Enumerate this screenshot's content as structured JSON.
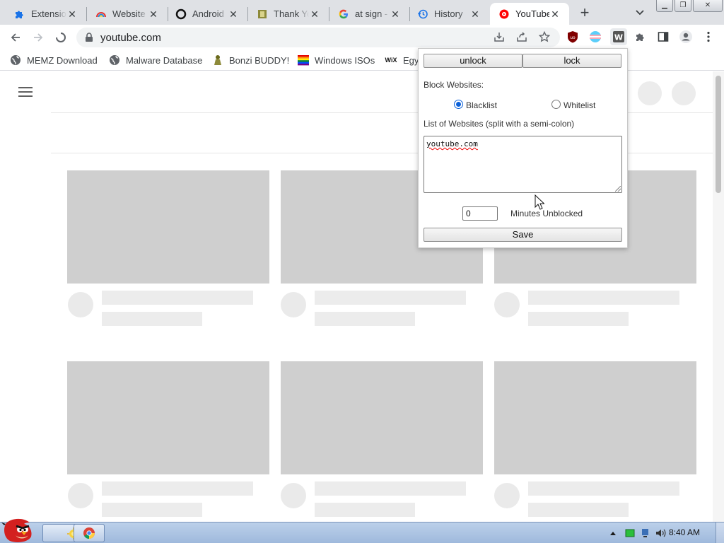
{
  "browser": {
    "tabs": [
      {
        "title": "Extensions",
        "icon": "puzzle-icon"
      },
      {
        "title": "Website Blocker",
        "icon": "rainbow-icon"
      },
      {
        "title": "Android",
        "icon": "ring-icon"
      },
      {
        "title": "Thank You",
        "icon": "bonzi-icon"
      },
      {
        "title": "at sign - Google Search",
        "icon": "google-icon"
      },
      {
        "title": "History",
        "icon": "history-icon"
      },
      {
        "title": "YouTube",
        "icon": "youtube-icon",
        "active": true
      }
    ],
    "new_tab_label": "+",
    "tab_search_label": "⌄",
    "address": "youtube.com",
    "bookmarks": [
      {
        "label": "MEMZ Download",
        "icon": "globe-icon"
      },
      {
        "label": "Malware Database",
        "icon": "globe-icon"
      },
      {
        "label": "Bonzi BUDDY!",
        "icon": "bonzi-icon"
      },
      {
        "label": "Windows ISOs",
        "icon": "rainbow-icon"
      },
      {
        "label": "Egy",
        "icon": "wix-icon"
      }
    ],
    "wix_glyph": "WiX"
  },
  "popup": {
    "unlock_label": "unlock",
    "lock_label": "lock",
    "block_websites_label": "Block Websites:",
    "blacklist_label": "Blacklist",
    "whitelist_label": "Whitelist",
    "mode": "Blacklist",
    "list_label": "List of Websites (split with a semi-colon)",
    "list_value": "youtube.com",
    "minutes_value": "0",
    "minutes_label": "Minutes Unblocked",
    "save_label": "Save"
  },
  "taskbar": {
    "clock": "8:40 AM"
  },
  "colors": {
    "accent": "#1a73e8",
    "youtube_red": "#ff0000",
    "skeleton": "#cfcfcf"
  }
}
